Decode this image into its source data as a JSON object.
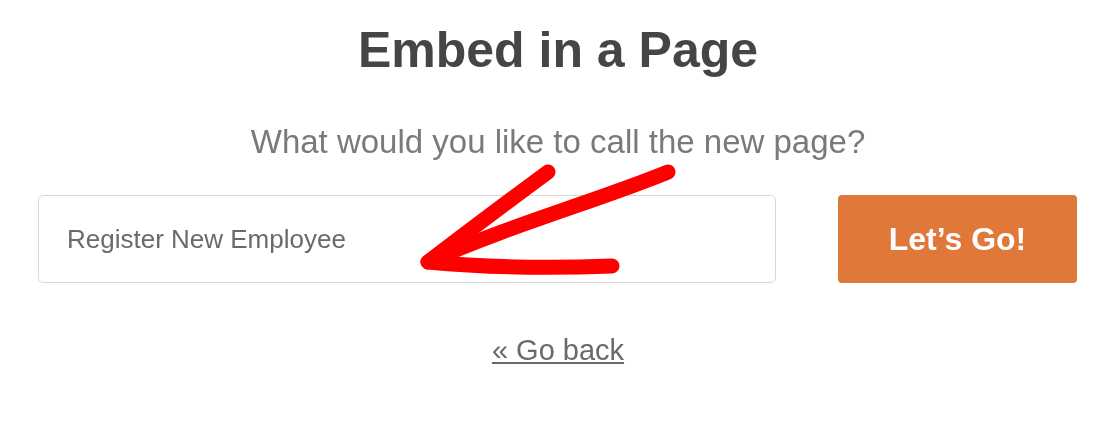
{
  "title": "Embed in a Page",
  "prompt": "What would you like to call the new page?",
  "page_name": {
    "value": "Register New Employee"
  },
  "submit_button": {
    "label": "Let’s Go!"
  },
  "back_link": {
    "label": "« Go back"
  }
}
